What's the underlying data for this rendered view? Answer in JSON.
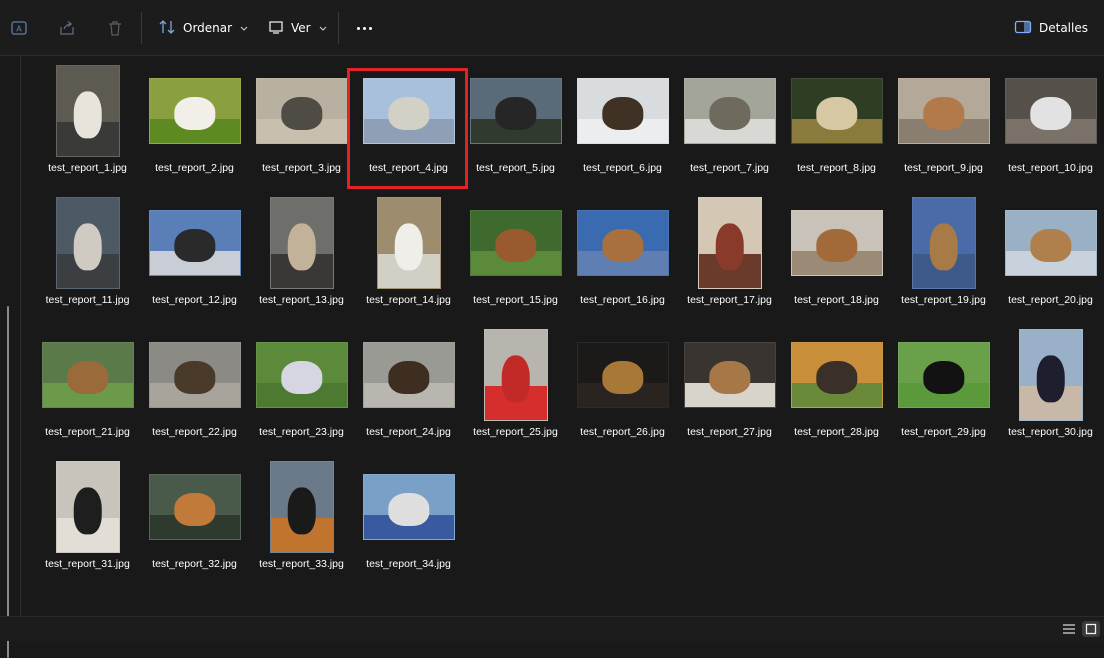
{
  "toolbar": {
    "sort_label": "Ordenar",
    "view_label": "Ver",
    "details_label": "Detalles",
    "icons": [
      "rename-icon",
      "share-icon",
      "delete-icon",
      "sort-icon",
      "view-icon",
      "more-icon",
      "details-pane-icon"
    ]
  },
  "selected_index": 3,
  "files": [
    {
      "name": "test_report_1.jpg",
      "bg": "#5d5a52",
      "fg": "#e8e4dc",
      "ground": "#3a3a38",
      "shape": "portrait"
    },
    {
      "name": "test_report_2.jpg",
      "bg": "#8aa040",
      "fg": "#f1efe7",
      "ground": "#5e8a22",
      "shape": "wide"
    },
    {
      "name": "test_report_3.jpg",
      "bg": "#b8b0a0",
      "fg": "#4f4b45",
      "ground": "#c9bfae",
      "shape": "wide"
    },
    {
      "name": "test_report_4.jpg",
      "bg": "#a9c0dc",
      "fg": "#d3d0c6",
      "ground": "#8f9fb5",
      "shape": "wide"
    },
    {
      "name": "test_report_5.jpg",
      "bg": "#5a6a78",
      "fg": "#262626",
      "ground": "#303a2f",
      "shape": "wide"
    },
    {
      "name": "test_report_6.jpg",
      "bg": "#d9dcdf",
      "fg": "#3f3225",
      "ground": "#ecedef",
      "shape": "wide"
    },
    {
      "name": "test_report_7.jpg",
      "bg": "#a3a59b",
      "fg": "#6e6a5d",
      "ground": "#d8d8d4",
      "shape": "wide"
    },
    {
      "name": "test_report_8.jpg",
      "bg": "#2e3e22",
      "fg": "#d7c8a4",
      "ground": "#8a7a3c",
      "shape": "wide"
    },
    {
      "name": "test_report_9.jpg",
      "bg": "#b4a898",
      "fg": "#b27a4a",
      "ground": "#8a7e70",
      "shape": "wide"
    },
    {
      "name": "test_report_10.jpg",
      "bg": "#55504a",
      "fg": "#e2e2e2",
      "ground": "#7a7268",
      "shape": "wide"
    },
    {
      "name": "test_report_11.jpg",
      "bg": "#4d5a66",
      "fg": "#cfcac2",
      "ground": "#3b3f42",
      "shape": "portrait"
    },
    {
      "name": "test_report_12.jpg",
      "bg": "#5a7fb8",
      "fg": "#2a2a2a",
      "ground": "#c9cdd6",
      "shape": "wide"
    },
    {
      "name": "test_report_13.jpg",
      "bg": "#6e6e6a",
      "fg": "#c2b29a",
      "ground": "#3a3836",
      "shape": "portrait"
    },
    {
      "name": "test_report_14.jpg",
      "bg": "#9d8d6e",
      "fg": "#efeee8",
      "ground": "#d2cfc4",
      "shape": "portrait"
    },
    {
      "name": "test_report_15.jpg",
      "bg": "#3e6a2e",
      "fg": "#9a5a30",
      "ground": "#5a8a3a",
      "shape": "wide"
    },
    {
      "name": "test_report_16.jpg",
      "bg": "#3a6ab0",
      "fg": "#a8703c",
      "ground": "#5f7fb2",
      "shape": "wide"
    },
    {
      "name": "test_report_17.jpg",
      "bg": "#d4c8b4",
      "fg": "#8a3a2a",
      "ground": "#6a3a2a",
      "shape": "portrait"
    },
    {
      "name": "test_report_18.jpg",
      "bg": "#c8c2b8",
      "fg": "#a26a38",
      "ground": "#9a8a76",
      "shape": "wide"
    },
    {
      "name": "test_report_19.jpg",
      "bg": "#4a6aa8",
      "fg": "#a87a48",
      "ground": "#3d5a8a",
      "shape": "portrait"
    },
    {
      "name": "test_report_20.jpg",
      "bg": "#9ab0c4",
      "fg": "#b0804c",
      "ground": "#c7d2dc",
      "shape": "wide"
    },
    {
      "name": "test_report_21.jpg",
      "bg": "#5a7a4a",
      "fg": "#9a6a3a",
      "ground": "#6a9a4a",
      "shape": "wide"
    },
    {
      "name": "test_report_22.jpg",
      "bg": "#8c8a84",
      "fg": "#4a3a2a",
      "ground": "#a8a49c",
      "shape": "wide"
    },
    {
      "name": "test_report_23.jpg",
      "bg": "#5a8a3a",
      "fg": "#d6d6e2",
      "ground": "#4c7a30",
      "shape": "wide"
    },
    {
      "name": "test_report_24.jpg",
      "bg": "#9a9a94",
      "fg": "#3e2e22",
      "ground": "#b8b6ae",
      "shape": "wide"
    },
    {
      "name": "test_report_25.jpg",
      "bg": "#b8b4ae",
      "fg": "#c22a28",
      "ground": "#d62e2c",
      "shape": "portrait"
    },
    {
      "name": "test_report_26.jpg",
      "bg": "#1c1a18",
      "fg": "#a87838",
      "ground": "#2a2420",
      "shape": "wide"
    },
    {
      "name": "test_report_27.jpg",
      "bg": "#3a3430",
      "fg": "#a67848",
      "ground": "#d8d4cc",
      "shape": "wide"
    },
    {
      "name": "test_report_28.jpg",
      "bg": "#c88e3a",
      "fg": "#3a3028",
      "ground": "#6a8a3a",
      "shape": "wide"
    },
    {
      "name": "test_report_29.jpg",
      "bg": "#6aa04a",
      "fg": "#121212",
      "ground": "#5a9a3a",
      "shape": "wide"
    },
    {
      "name": "test_report_30.jpg",
      "bg": "#9ab0c8",
      "fg": "#1e1e2e",
      "ground": "#c8b8a8",
      "shape": "portrait"
    },
    {
      "name": "test_report_31.jpg",
      "bg": "#c8c4bc",
      "fg": "#1e1e1e",
      "ground": "#e2ded6",
      "shape": "portrait"
    },
    {
      "name": "test_report_32.jpg",
      "bg": "#4a5a4a",
      "fg": "#c27a3a",
      "ground": "#2f3a2f",
      "shape": "wide"
    },
    {
      "name": "test_report_33.jpg",
      "bg": "#6a7a8a",
      "fg": "#1a1a1a",
      "ground": "#c0742e",
      "shape": "portrait"
    },
    {
      "name": "test_report_34.jpg",
      "bg": "#7aa0c8",
      "fg": "#dedede",
      "ground": "#3a5aa0",
      "shape": "wide"
    }
  ],
  "status_bar": {
    "icons": [
      "details-view-icon",
      "large-icons-view-icon"
    ]
  }
}
